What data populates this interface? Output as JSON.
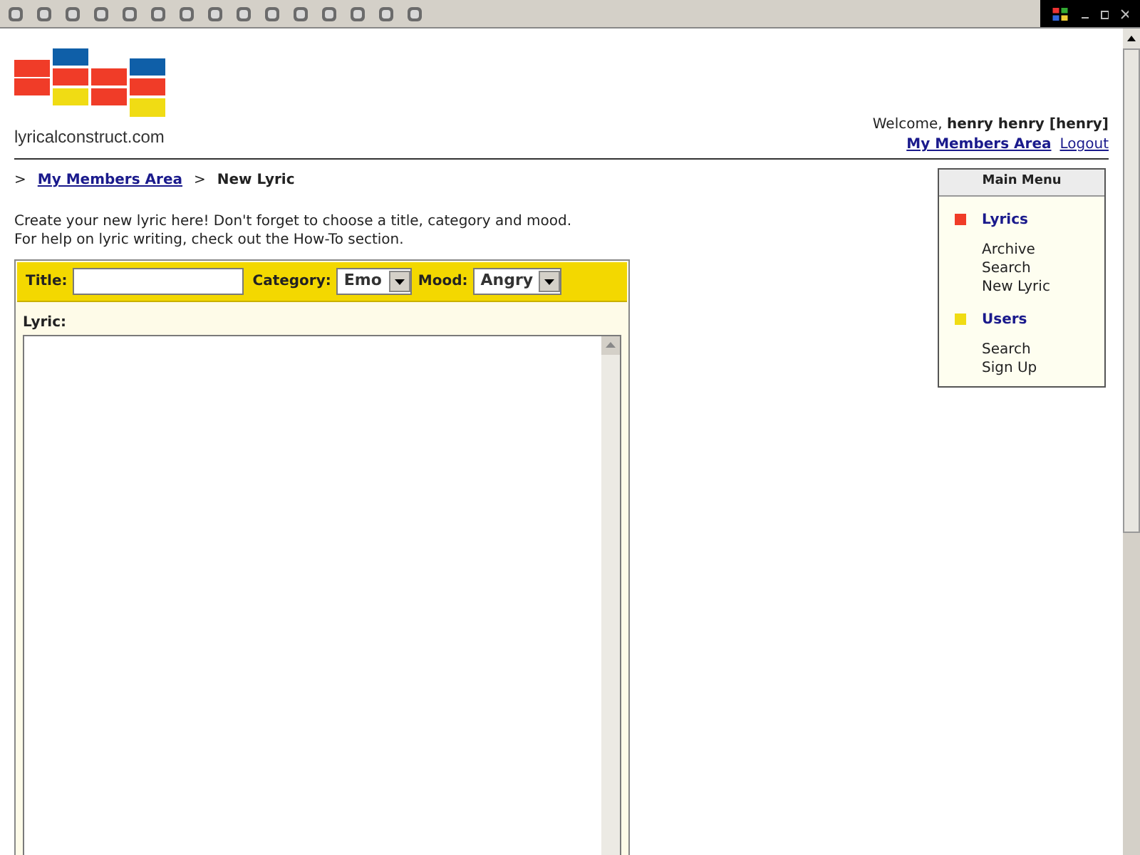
{
  "site": {
    "name": "lyricalconstruct.com"
  },
  "account": {
    "welcome": "Welcome,",
    "user": "henry henry [henry]",
    "links": [
      "My Members Area",
      "Logout"
    ]
  },
  "breadcrumb": [
    {
      "text": ">",
      "kind": "sep"
    },
    {
      "text": "My Members Area",
      "kind": "link"
    },
    {
      "text": ">",
      "kind": "sep"
    },
    {
      "text": "New Lyric",
      "kind": "current"
    }
  ],
  "intro": [
    "Create your new lyric here! Don't forget to choose a title, category and mood.",
    "For help on lyric writing, check out the How-To section."
  ],
  "form": {
    "title_label": "Title:",
    "category_label": "Category:",
    "category": "Emo",
    "mood_label": "Mood:",
    "mood": "Angry",
    "lyric_label": "Lyric:"
  },
  "menu": {
    "title": "Main Menu",
    "sections": [
      {
        "heading": "Lyrics",
        "color": "#f03c28",
        "items": [
          "Archive",
          "Search",
          "New Lyric"
        ]
      },
      {
        "heading": "Users",
        "color": "#f0dc14",
        "items": [
          "Search",
          "Sign Up"
        ]
      }
    ]
  }
}
